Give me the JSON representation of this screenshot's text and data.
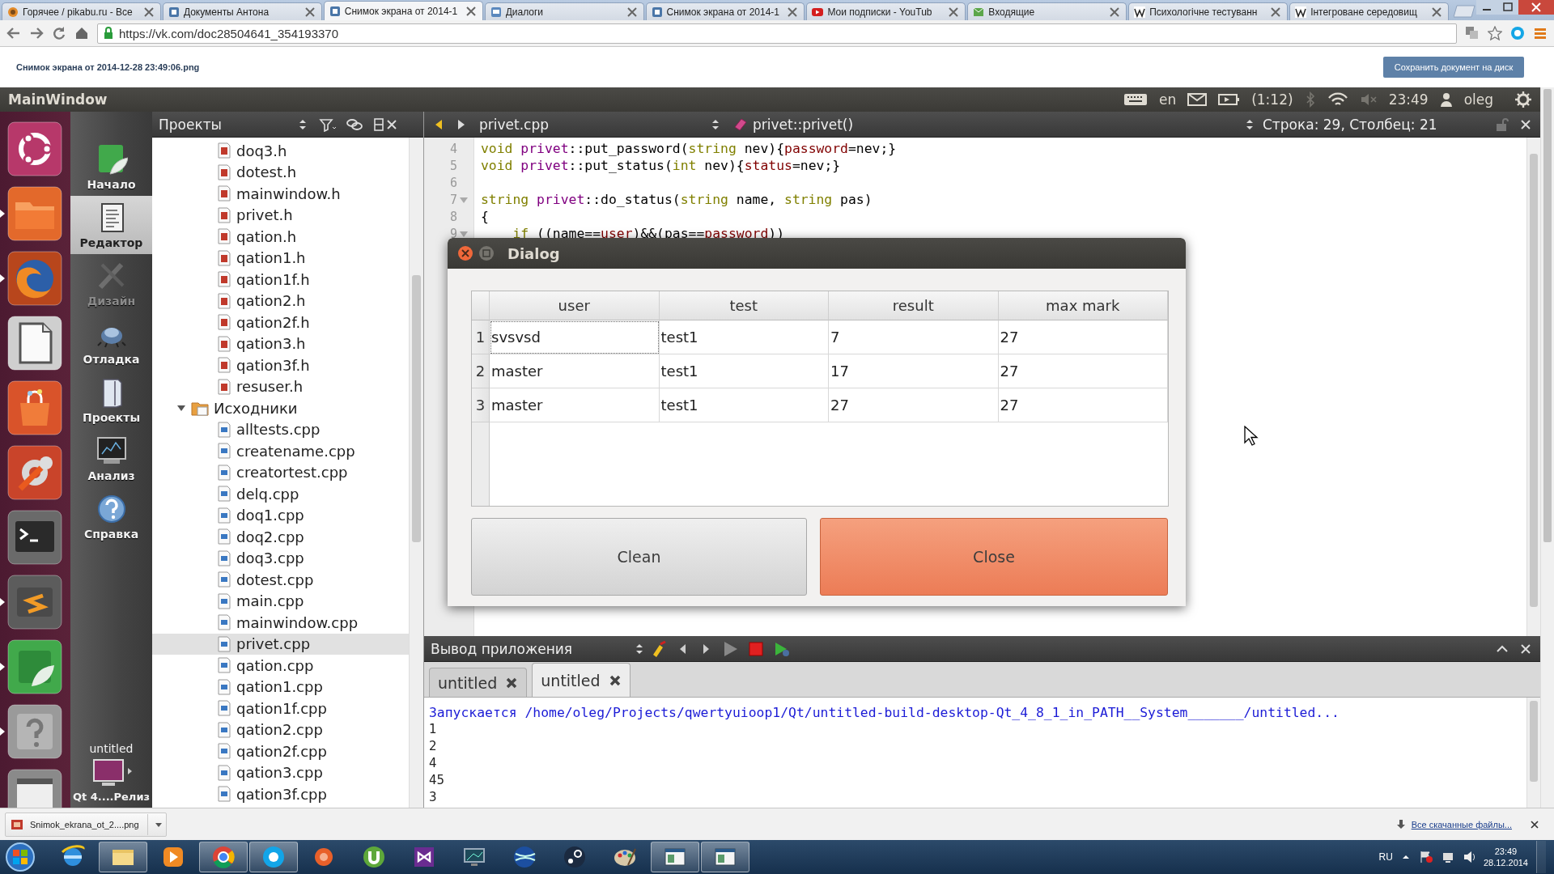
{
  "browser": {
    "tabs": [
      {
        "title": "Горячее / pikabu.ru - Все",
        "selected": false
      },
      {
        "title": "Документы Антона",
        "selected": false
      },
      {
        "title": "Снимок экрана от 2014-1",
        "selected": true
      },
      {
        "title": "Диалоги",
        "selected": false
      },
      {
        "title": "Снимок экрана от 2014-1",
        "selected": false
      },
      {
        "title": "Мои подписки - YouTub",
        "selected": false
      },
      {
        "title": "Входящие",
        "selected": false
      },
      {
        "title": "Психологічне тестуванн",
        "selected": false
      },
      {
        "title": "Інтегроване середовищ",
        "selected": false
      }
    ],
    "url": "https://vk.com/doc28504641_354193370"
  },
  "document": {
    "filename": "Снимок экрана от 2014-12-28 23:49:06.png",
    "save_button": "Сохранить документ на диск"
  },
  "screen": {
    "panel": {
      "title": "MainWindow",
      "keyboard_layout": "en",
      "battery": "(1:12)",
      "time": "23:49",
      "user": "oleg"
    },
    "launcher": [
      {
        "running": false
      },
      {
        "running": true
      },
      {
        "running": true
      },
      {
        "running": false
      },
      {
        "running": false
      },
      {
        "running": false
      },
      {
        "running": false
      },
      {
        "running": true
      },
      {
        "running": true
      },
      {
        "running": true
      },
      {
        "running": false
      }
    ],
    "modes": [
      {
        "label": "Начало",
        "selected": false,
        "disabled": false
      },
      {
        "label": "Редактор",
        "selected": true,
        "disabled": false
      },
      {
        "label": "Дизайн",
        "selected": false,
        "disabled": true
      },
      {
        "label": "Отладка",
        "selected": false,
        "disabled": false
      },
      {
        "label": "Проекты",
        "selected": false,
        "disabled": false
      },
      {
        "label": "Анализ",
        "selected": false,
        "disabled": false
      },
      {
        "label": "Справка",
        "selected": false,
        "disabled": false
      }
    ],
    "target": {
      "project": "untitled",
      "config": "Qt 4....Релиз"
    },
    "projects_pane": {
      "title": "Проекты",
      "tree": [
        {
          "name": "doq3.h",
          "kind": "header",
          "selected": false
        },
        {
          "name": "dotest.h",
          "kind": "header",
          "selected": false
        },
        {
          "name": "mainwindow.h",
          "kind": "header",
          "selected": false
        },
        {
          "name": "privet.h",
          "kind": "header",
          "selected": false
        },
        {
          "name": "qation.h",
          "kind": "header",
          "selected": false
        },
        {
          "name": "qation1.h",
          "kind": "header",
          "selected": false
        },
        {
          "name": "qation1f.h",
          "kind": "header",
          "selected": false
        },
        {
          "name": "qation2.h",
          "kind": "header",
          "selected": false
        },
        {
          "name": "qation2f.h",
          "kind": "header",
          "selected": false
        },
        {
          "name": "qation3.h",
          "kind": "header",
          "selected": false
        },
        {
          "name": "qation3f.h",
          "kind": "header",
          "selected": false
        },
        {
          "name": "resuser.h",
          "kind": "header",
          "selected": false
        },
        {
          "name": "Исходники",
          "kind": "folder",
          "selected": false,
          "expanded": true,
          "children": [
            {
              "name": "alltests.cpp",
              "kind": "source",
              "selected": false
            },
            {
              "name": "createname.cpp",
              "kind": "source",
              "selected": false
            },
            {
              "name": "creatortest.cpp",
              "kind": "source",
              "selected": false
            },
            {
              "name": "delq.cpp",
              "kind": "source",
              "selected": false
            },
            {
              "name": "doq1.cpp",
              "kind": "source",
              "selected": false
            },
            {
              "name": "doq2.cpp",
              "kind": "source",
              "selected": false
            },
            {
              "name": "doq3.cpp",
              "kind": "source",
              "selected": false
            },
            {
              "name": "dotest.cpp",
              "kind": "source",
              "selected": false
            },
            {
              "name": "main.cpp",
              "kind": "source",
              "selected": false
            },
            {
              "name": "mainwindow.cpp",
              "kind": "source",
              "selected": false
            },
            {
              "name": "privet.cpp",
              "kind": "source",
              "selected": true
            },
            {
              "name": "qation.cpp",
              "kind": "source",
              "selected": false
            },
            {
              "name": "qation1.cpp",
              "kind": "source",
              "selected": false
            },
            {
              "name": "qation1f.cpp",
              "kind": "source",
              "selected": false
            },
            {
              "name": "qation2.cpp",
              "kind": "source",
              "selected": false
            },
            {
              "name": "qation2f.cpp",
              "kind": "source",
              "selected": false
            },
            {
              "name": "qation3.cpp",
              "kind": "source",
              "selected": false
            },
            {
              "name": "qation3f.cpp",
              "kind": "source",
              "selected": false
            }
          ]
        }
      ]
    },
    "editor": {
      "file": "privet.cpp",
      "symbol": "privet::privet()",
      "position": "Строка: 29, Столбец: 21",
      "lines": [
        {
          "number": "4",
          "foldable": false,
          "tokens": [
            {
              "kind": "type",
              "text": "void "
            },
            {
              "kind": "class",
              "text": "privet"
            },
            {
              "kind": "plain",
              "text": "::put_password("
            },
            {
              "kind": "type",
              "text": "string"
            },
            {
              "kind": "plain",
              "text": " nev){"
            },
            {
              "kind": "member",
              "text": "password"
            },
            {
              "kind": "plain",
              "text": "=nev;}"
            }
          ]
        },
        {
          "number": "5",
          "foldable": false,
          "tokens": [
            {
              "kind": "type",
              "text": "void "
            },
            {
              "kind": "class",
              "text": "privet"
            },
            {
              "kind": "plain",
              "text": "::put_status("
            },
            {
              "kind": "type",
              "text": "int"
            },
            {
              "kind": "plain",
              "text": " nev){"
            },
            {
              "kind": "member",
              "text": "status"
            },
            {
              "kind": "plain",
              "text": "=nev;}"
            }
          ]
        },
        {
          "number": "6",
          "foldable": false
        },
        {
          "number": "7",
          "foldable": true,
          "tokens": [
            {
              "kind": "type",
              "text": "string "
            },
            {
              "kind": "class",
              "text": "privet"
            },
            {
              "kind": "plain",
              "text": "::do_status("
            },
            {
              "kind": "type",
              "text": "string"
            },
            {
              "kind": "plain",
              "text": " name, "
            },
            {
              "kind": "type",
              "text": "string"
            },
            {
              "kind": "plain",
              "text": " pas)"
            }
          ]
        },
        {
          "number": "8",
          "foldable": false,
          "tokens": [
            {
              "kind": "plain",
              "text": "{"
            }
          ]
        },
        {
          "number": "9",
          "foldable": true,
          "tokens": [
            {
              "kind": "keyword",
              "text": "    if"
            },
            {
              "kind": "plain",
              "text": " ((name=="
            },
            {
              "kind": "member",
              "text": "user"
            },
            {
              "kind": "plain",
              "text": ")&&(pas=="
            },
            {
              "kind": "member",
              "text": "password"
            },
            {
              "kind": "plain",
              "text": "))"
            }
          ]
        }
      ]
    },
    "output": {
      "title": "Вывод приложения",
      "tabs": [
        {
          "label": "untitled",
          "selected": false
        },
        {
          "label": "untitled",
          "selected": true
        }
      ],
      "lines": [
        {
          "kind": "info",
          "text": "Запускается /home/oleg/Projects/qwertyuioop1/Qt/untitled-build-desktop-Qt_4_8_1_in_PATH__System_______/untitled..."
        },
        {
          "kind": "stdout",
          "text": "1"
        },
        {
          "kind": "stdout",
          "text": "2"
        },
        {
          "kind": "stdout",
          "text": "4"
        },
        {
          "kind": "stdout",
          "text": "45"
        },
        {
          "kind": "stdout",
          "text": "3"
        }
      ]
    },
    "dialog": {
      "title": "Dialog",
      "table": {
        "columns": [
          "user",
          "test",
          "result",
          "max mark"
        ],
        "rows": [
          {
            "header": "1",
            "cells": [
              {
                "text": "svsvsd",
                "selected": true
              },
              {
                "text": "test1",
                "selected": false
              },
              {
                "text": "7",
                "selected": false
              },
              {
                "text": "27",
                "selected": false
              }
            ]
          },
          {
            "header": "2",
            "cells": [
              {
                "text": "master",
                "selected": false
              },
              {
                "text": "test1",
                "selected": false
              },
              {
                "text": "17",
                "selected": false
              },
              {
                "text": "27",
                "selected": false
              }
            ]
          },
          {
            "header": "3",
            "cells": [
              {
                "text": "master",
                "selected": false
              },
              {
                "text": "test1",
                "selected": false
              },
              {
                "text": "27",
                "selected": false
              },
              {
                "text": "27",
                "selected": false
              }
            ]
          }
        ]
      },
      "buttons": [
        {
          "label": "Clean",
          "default": false
        },
        {
          "label": "Close",
          "default": true
        }
      ]
    }
  },
  "downloads": {
    "file": "Snimok_ekrana_ot_2....png",
    "show_all": "Все скачанные файлы..."
  },
  "taskbar": {
    "items": [
      {
        "open": false
      },
      {
        "open": true
      },
      {
        "open": false
      },
      {
        "open": true
      },
      {
        "open": true
      },
      {
        "open": false
      },
      {
        "open": false
      },
      {
        "open": false
      },
      {
        "open": false
      },
      {
        "open": false
      },
      {
        "open": false
      },
      {
        "open": false
      },
      {
        "open": true
      },
      {
        "open": true
      }
    ],
    "language": "RU",
    "time": "23:49",
    "date": "28.12.2014"
  }
}
